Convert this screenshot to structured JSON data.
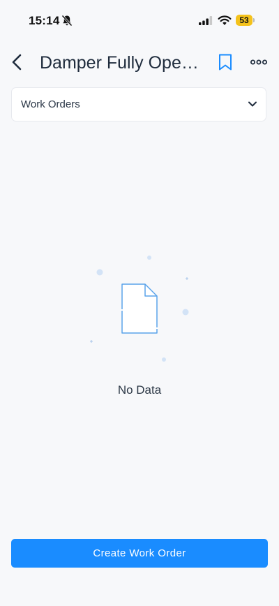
{
  "status_bar": {
    "time": "15:14",
    "battery_level": "53",
    "icons": [
      "bell-slash-icon",
      "cellular-signal-icon",
      "wifi-icon",
      "battery-icon"
    ],
    "battery_color": "#f4c21b"
  },
  "header": {
    "title": "Damper Fully Open Sensor Alarm",
    "back_icon": "chevron-left-icon",
    "bookmark_icon": "bookmark-icon",
    "more_icon": "ellipsis-icon"
  },
  "filter": {
    "selected": "Work Orders",
    "icon": "chevron-down-icon"
  },
  "empty_state": {
    "message": "No Data",
    "icon": "empty-document-icon"
  },
  "actions": {
    "create_label": "Create Work Order"
  },
  "colors": {
    "primary": "#1a8cff",
    "background": "#f7f8fa",
    "text": "#1e2b3c"
  }
}
